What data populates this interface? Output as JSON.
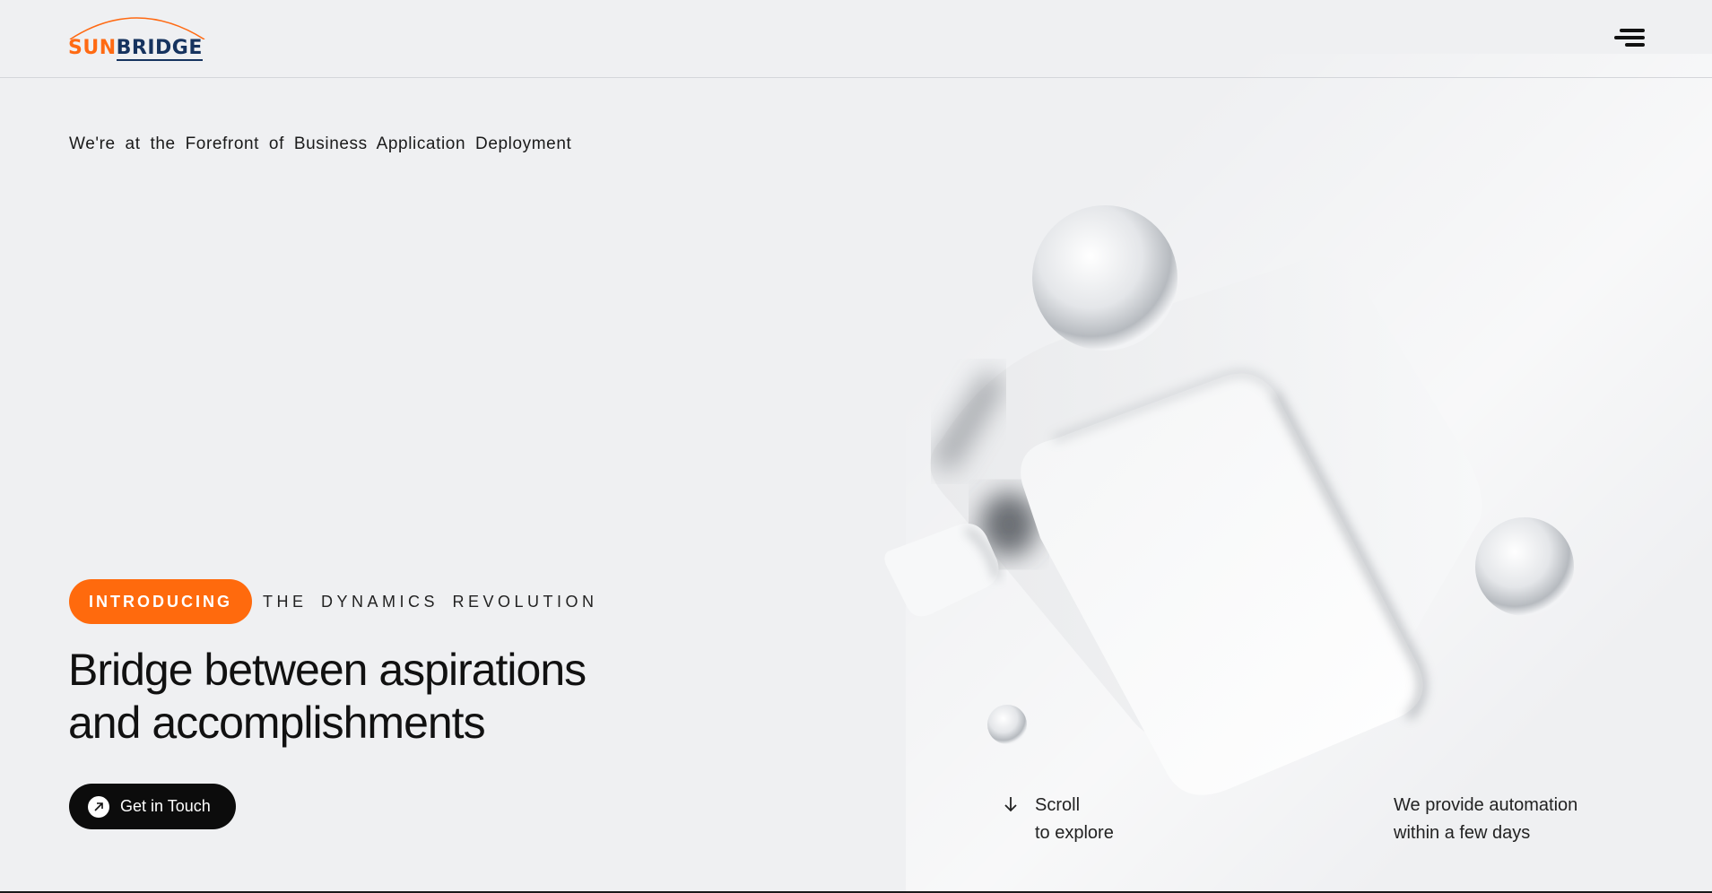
{
  "brand": {
    "logo_part1": "SUN",
    "logo_part2": "BRIDGE",
    "accent_color": "#ff6a13",
    "brand_navy": "#16335f"
  },
  "header": {
    "menu_icon": "hamburger-menu-icon"
  },
  "hero": {
    "tagline": "We're at the Forefront of Business Application Deployment",
    "badge_label": "INTRODUCING",
    "badge_color": "#ff6a0d",
    "subtitle": "THE DYNAMICS REVOLUTION",
    "headline_line1": "Bridge between aspirations",
    "headline_line2": "and accomplishments",
    "cta_label": "Get in Touch",
    "cta_icon": "arrow-up-right-icon"
  },
  "footer_hints": {
    "scroll_line1": "Scroll",
    "scroll_line2": "to explore",
    "scroll_icon": "arrow-down-icon",
    "note_line1": "We provide automation",
    "note_line2": "within a few days"
  }
}
